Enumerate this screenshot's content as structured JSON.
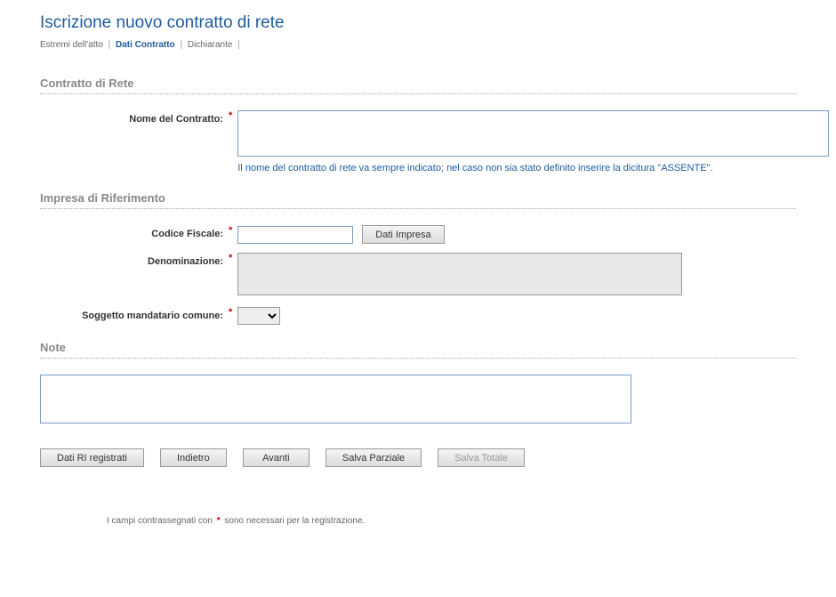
{
  "header": {
    "title": "Iscrizione nuovo contratto di rete"
  },
  "breadcrumb": {
    "items": [
      {
        "label": "Estremi dell'atto",
        "active": false
      },
      {
        "label": "Dati Contratto",
        "active": true
      },
      {
        "label": "Dichiarante",
        "active": false
      }
    ]
  },
  "sections": {
    "contratto": {
      "header": "Contratto di Rete",
      "nome_label": "Nome del Contratto:",
      "nome_value": "",
      "nome_hint": "Il nome del contratto di rete va sempre indicato; nel caso non sia stato definito inserire la dicitura \"ASSENTE\"."
    },
    "impresa": {
      "header": "Impresa di Riferimento",
      "cf_label": "Codice Fiscale:",
      "cf_value": "",
      "btn_dati_impresa": "Dati Impresa",
      "denom_label": "Denominazione:",
      "denom_value": "",
      "soggetto_label": "Soggetto mandatario comune:",
      "soggetto_value": ""
    },
    "note": {
      "header": "Note",
      "value": ""
    }
  },
  "buttons": {
    "dati_ri": "Dati RI registrati",
    "indietro": "Indietro",
    "avanti": "Avanti",
    "salva_parziale": "Salva Parziale",
    "salva_totale": "Salva Totale"
  },
  "footnote": {
    "prefix": "I campi contrassegnati con ",
    "suffix": " sono necessari per la registrazione."
  }
}
